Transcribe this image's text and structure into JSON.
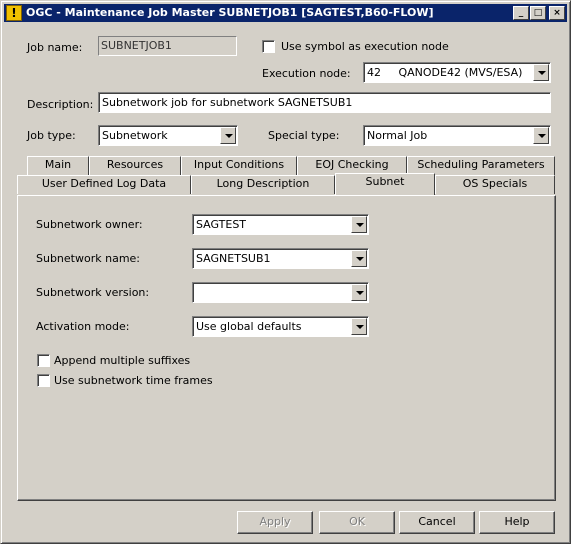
{
  "window": {
    "title": "OGC - Maintenance Job Master SUBNETJOB1 [SAGTEST,B60-FLOW]",
    "icon": "warning-icon",
    "controls": {
      "minimize": "_",
      "maximize": "□",
      "close": "×"
    }
  },
  "header": {
    "job_name_label": "Job name:",
    "job_name_value": "SUBNETJOB1",
    "use_symbol_label": "Use symbol as execution node",
    "execution_node_label": "Execution node:",
    "execution_node_value": "42     QANODE42 (MVS/ESA)",
    "description_label": "Description:",
    "description_value": "Subnetwork job for subnetwork SAGNETSUB1",
    "job_type_label": "Job type:",
    "job_type_value": "Subnetwork",
    "special_type_label": "Special type:",
    "special_type_value": "Normal Job"
  },
  "tabs": {
    "row1": [
      "Main",
      "Resources",
      "Input Conditions",
      "EOJ Checking",
      "Scheduling Parameters"
    ],
    "row2": [
      "User Defined Log Data",
      "Long Description",
      "Subnet",
      "OS Specials"
    ],
    "active": "Subnet"
  },
  "subnet": {
    "owner_label": "Subnetwork owner:",
    "owner_value": "SAGTEST",
    "name_label": "Subnetwork name:",
    "name_value": "SAGNETSUB1",
    "version_label": "Subnetwork version:",
    "version_value": "",
    "activation_label": "Activation mode:",
    "activation_value": "Use global defaults",
    "append_suffixes_label": "Append multiple suffixes",
    "use_time_frames_label": "Use subnetwork time frames"
  },
  "buttons": {
    "apply": "Apply",
    "ok": "OK",
    "cancel": "Cancel",
    "help": "Help"
  },
  "colors": {
    "titlebar": "#0a246a",
    "face": "#d4d0c8",
    "disabled_text": "#808080"
  }
}
